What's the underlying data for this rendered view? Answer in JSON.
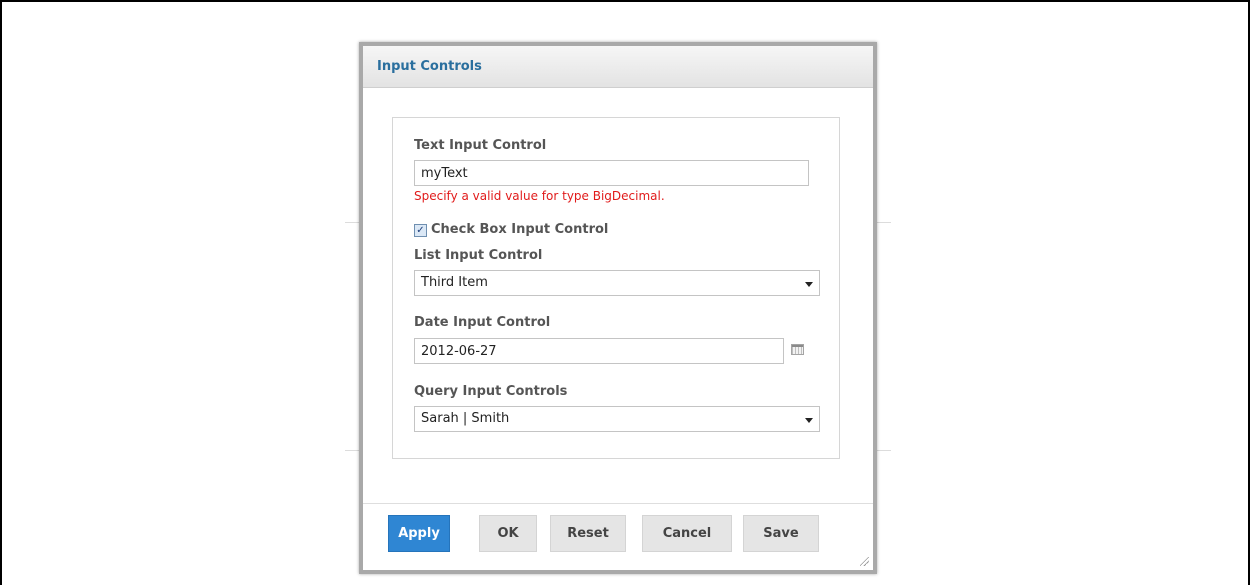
{
  "dialog": {
    "title": "Input Controls"
  },
  "controls": {
    "text": {
      "label": "Text Input Control",
      "value": "myText",
      "error": "Specify a valid value for type BigDecimal."
    },
    "checkbox": {
      "label": "Check Box Input Control",
      "checked": true,
      "mark": "✓"
    },
    "list": {
      "label": "List Input Control",
      "selected": "Third Item"
    },
    "date": {
      "label": "Date Input Control",
      "value": "2012-06-27",
      "icon": "calendar-icon"
    },
    "query": {
      "label": "Query Input Controls",
      "selected": "Sarah | Smith"
    }
  },
  "buttons": {
    "apply": "Apply",
    "ok": "OK",
    "reset": "Reset",
    "cancel": "Cancel",
    "save": "Save"
  },
  "colors": {
    "title": "#2a6f9e",
    "error": "#e11b1b",
    "apply_button": "#2f86d3"
  }
}
